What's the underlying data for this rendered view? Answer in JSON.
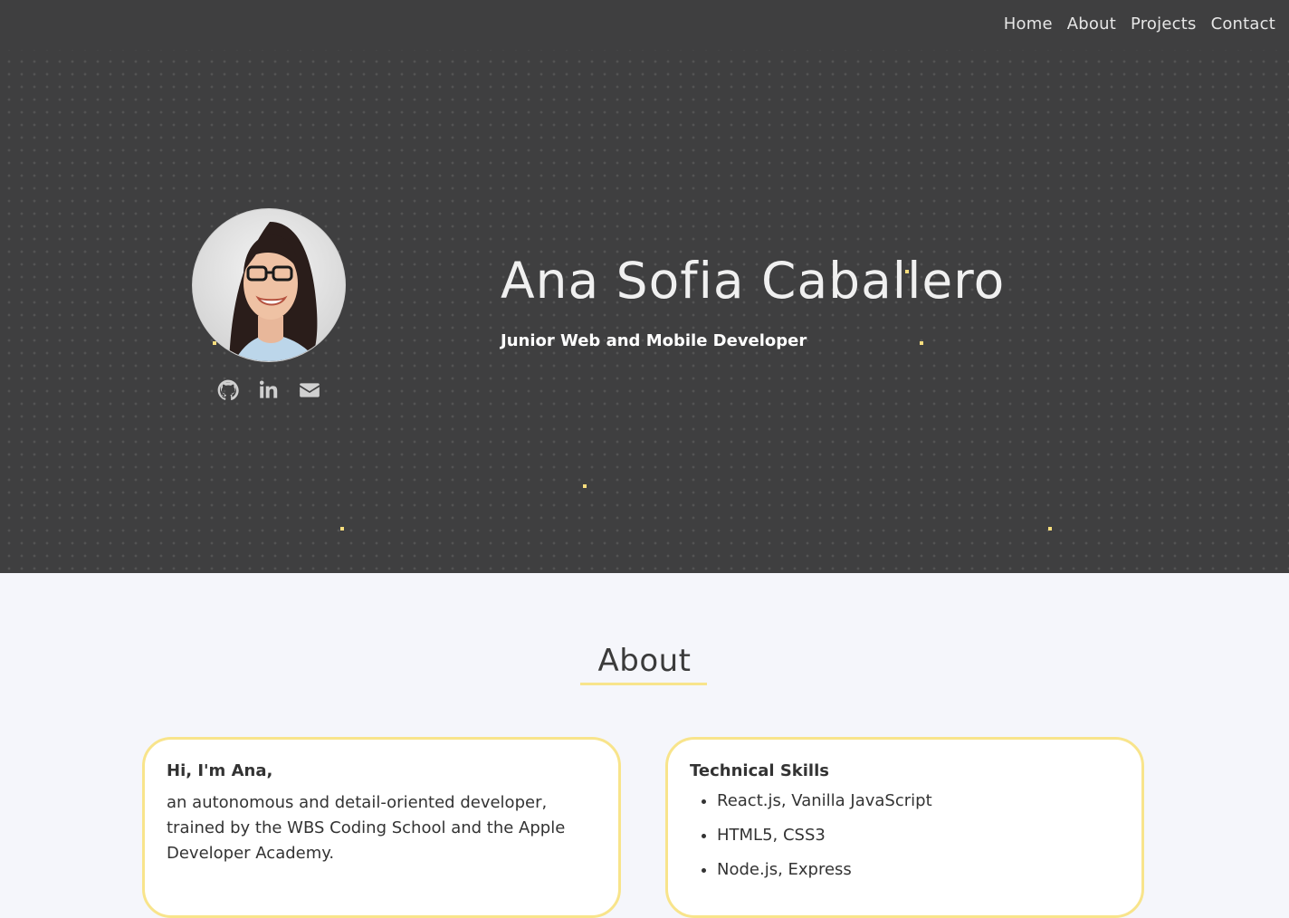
{
  "nav": {
    "items": [
      "Home",
      "About",
      "Projects",
      "Contact"
    ]
  },
  "hero": {
    "name": "Ana Sofia Caballero",
    "role": "Junior Web and Mobile Developer",
    "social_icons": [
      "github-icon",
      "linkedin-icon",
      "mail-icon"
    ],
    "accent_color": "#f7dd7d",
    "background_color": "#3f3f40"
  },
  "about": {
    "title": "About",
    "intro_card": {
      "heading": "Hi, I'm Ana,",
      "text": "an autonomous and detail-oriented developer, trained by the WBS Coding School and the Apple Developer Academy."
    },
    "skills_card": {
      "heading": "Technical Skills",
      "items": [
        "React.js, Vanilla JavaScript",
        "HTML5, CSS3",
        "Node.js, Express"
      ]
    },
    "card_border_color": "#f8e48b"
  }
}
